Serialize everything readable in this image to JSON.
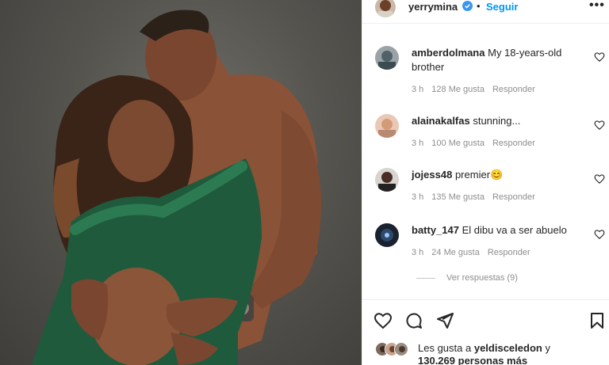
{
  "post": {
    "username": "yerrymina",
    "follow_label": "Seguir",
    "dot": "•",
    "more_label": "•••",
    "verified_icon": "verified-badge-icon"
  },
  "comments": [
    {
      "user": "amberdolmana",
      "text": "My 18-years-old brother",
      "time": "3 h",
      "likes": "128 Me gusta",
      "reply": "Responder"
    },
    {
      "user": "alainakalfas",
      "text": "stunning...",
      "time": "3 h",
      "likes": "100 Me gusta",
      "reply": "Responder"
    },
    {
      "user": "jojess48",
      "text": "premier😊",
      "time": "3 h",
      "likes": "135 Me gusta",
      "reply": "Responder"
    },
    {
      "user": "batty_147",
      "text": "El dibu va a ser abuelo",
      "time": "3 h",
      "likes": "24 Me gusta",
      "reply": "Responder"
    }
  ],
  "view_replies": "Ver respuestas (9)",
  "likes": {
    "prefix": "Les gusta a",
    "user": "yeldisceledon",
    "conj": "y",
    "count": "130.269",
    "suffix": "personas más"
  },
  "colors": {
    "link": "#0095f6",
    "meta": "#8e8e8e",
    "text": "#262626",
    "dress": "#1f5a3c"
  },
  "icons": [
    "heart-icon",
    "comment-icon",
    "share-icon",
    "bookmark-icon"
  ]
}
